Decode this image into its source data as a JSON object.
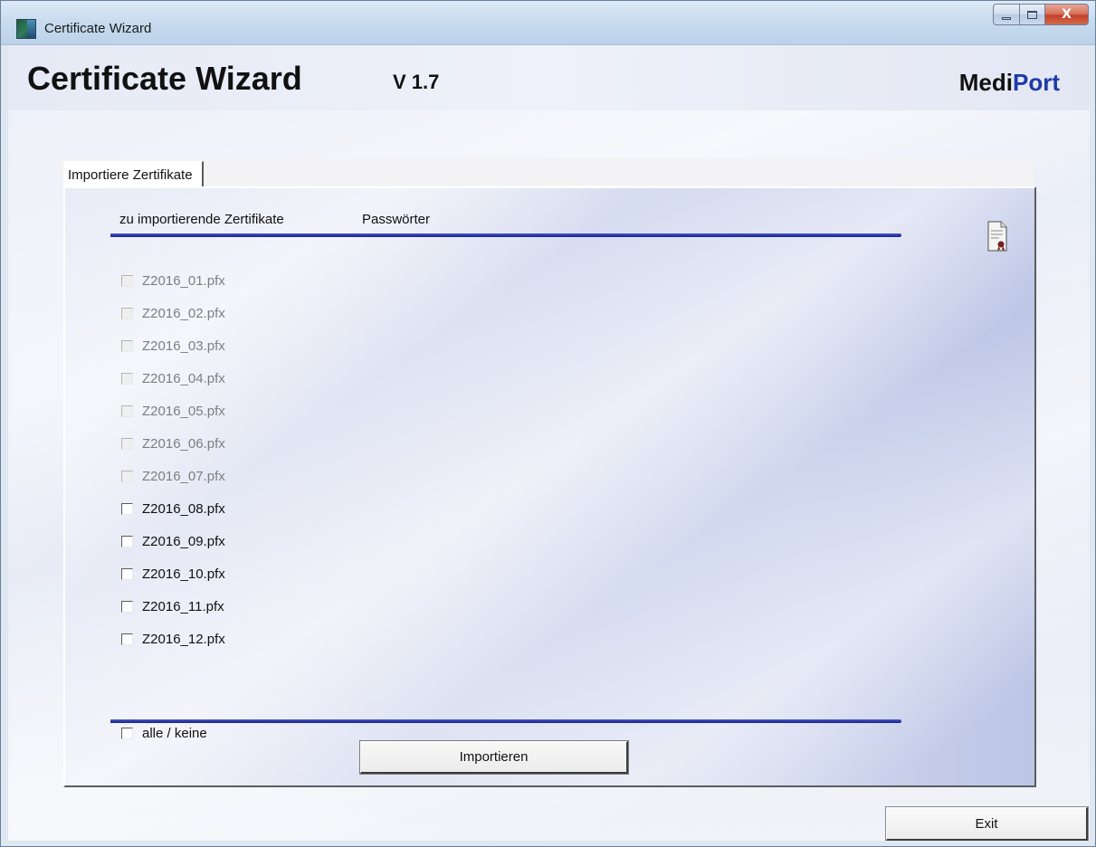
{
  "window": {
    "title": "Certificate Wizard",
    "minimize_icon": "minimize-icon",
    "maximize_icon": "maximize-icon",
    "close_glyph": "X"
  },
  "header": {
    "app_title": "Certificate Wizard",
    "version": "V 1.7",
    "brand_part1": "Medi",
    "brand_part2": "Port",
    "brand_color_part2": "#1e3aa8"
  },
  "tabs": [
    {
      "label": "Importiere  Zertifikate",
      "selected": true
    }
  ],
  "import_tab": {
    "col_certificates": "zu importierende Zertifikate",
    "col_passwords": "Passwörter",
    "certificate_icon": "certificate-icon",
    "rule_color": "#2b3aa8",
    "certificates": [
      {
        "label": "Z2016_01.pfx",
        "enabled": false,
        "checked": false
      },
      {
        "label": "Z2016_02.pfx",
        "enabled": false,
        "checked": false
      },
      {
        "label": "Z2016_03.pfx",
        "enabled": false,
        "checked": false
      },
      {
        "label": "Z2016_04.pfx",
        "enabled": false,
        "checked": false
      },
      {
        "label": "Z2016_05.pfx",
        "enabled": false,
        "checked": false
      },
      {
        "label": "Z2016_06.pfx",
        "enabled": false,
        "checked": false
      },
      {
        "label": "Z2016_07.pfx",
        "enabled": false,
        "checked": false
      },
      {
        "label": "Z2016_08.pfx",
        "enabled": true,
        "checked": false
      },
      {
        "label": "Z2016_09.pfx",
        "enabled": true,
        "checked": false
      },
      {
        "label": "Z2016_10.pfx",
        "enabled": true,
        "checked": false
      },
      {
        "label": "Z2016_11.pfx",
        "enabled": true,
        "checked": false
      },
      {
        "label": "Z2016_12.pfx",
        "enabled": true,
        "checked": false
      }
    ],
    "select_all_label": "alle / keine",
    "select_all_checked": false,
    "import_button": "Importieren"
  },
  "footer": {
    "exit_button": "Exit"
  }
}
